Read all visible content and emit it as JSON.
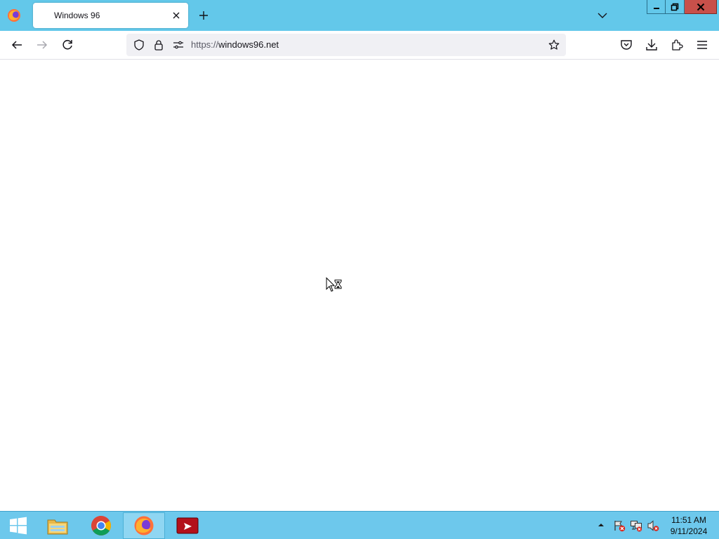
{
  "browser": {
    "tab": {
      "title": "Windows 96"
    },
    "url": {
      "protocol": "https://",
      "host": "windows96.net"
    }
  },
  "taskbar": {
    "apps": [
      "start",
      "file-explorer",
      "chrome",
      "firefox",
      "red-app"
    ],
    "active_app": "firefox"
  },
  "clock": {
    "time": "11:51 AM",
    "date": "9/11/2024"
  },
  "colors": {
    "tabstrip": "#63c8ea",
    "taskbar": "#6dc8ec",
    "close_button": "#c8504a",
    "urlbar": "#f0f0f4"
  }
}
